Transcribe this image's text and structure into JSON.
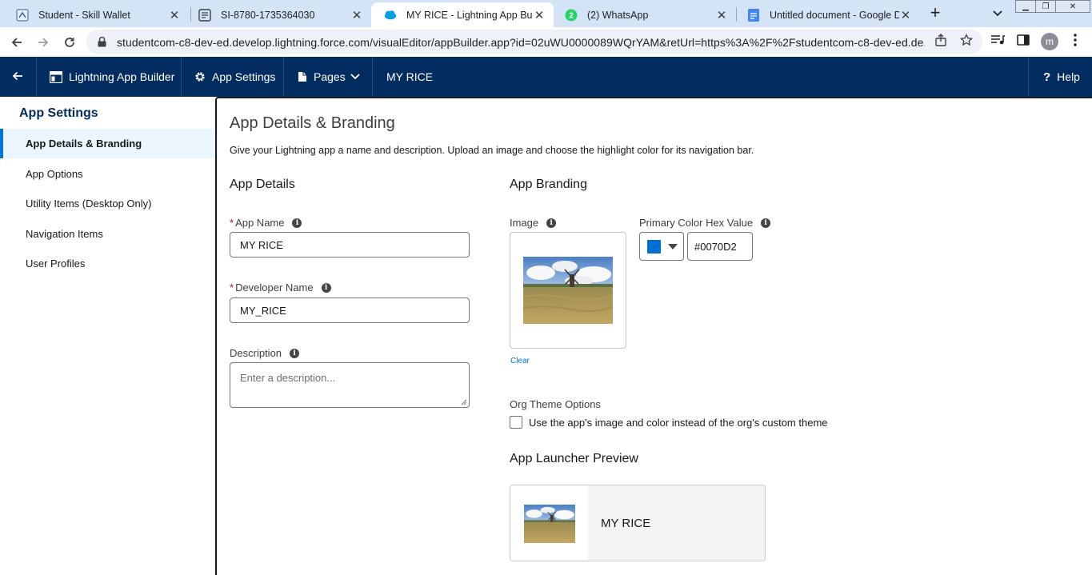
{
  "browser": {
    "tabs": [
      {
        "title": "Student - Skill Wallet",
        "icon": "skill-wallet-icon"
      },
      {
        "title": "SI-8780-1735364030",
        "icon": "form-icon"
      },
      {
        "title": "MY RICE - Lightning App Builder",
        "icon": "salesforce-cloud-icon",
        "active": true
      },
      {
        "title": "(2) WhatsApp",
        "icon": "whatsapp-icon"
      },
      {
        "title": "Untitled document - Google Docs",
        "icon": "google-docs-icon"
      }
    ],
    "url": "studentcom-c8-dev-ed.develop.lightning.force.com/visualEditor/appBuilder.app?id=02uWU0000089WQrYAM&retUrl=https%3A%2F%2Fstudentcom-c8-dev-ed.de...",
    "profile_initial": "m",
    "whatsapp_badge": "2"
  },
  "header": {
    "app_name": "Lightning App Builder",
    "app_settings": "App Settings",
    "pages": "Pages",
    "current_app": "MY RICE",
    "help": "Help"
  },
  "sidebar": {
    "title": "App Settings",
    "items": [
      {
        "label": "App Details & Branding",
        "active": true
      },
      {
        "label": "App Options"
      },
      {
        "label": "Utility Items (Desktop Only)"
      },
      {
        "label": "Navigation Items"
      },
      {
        "label": "User Profiles"
      }
    ]
  },
  "main": {
    "title": "App Details & Branding",
    "intro": "Give your Lightning app a name and description. Upload an image and choose the highlight color for its navigation bar.",
    "details": {
      "heading": "App Details",
      "app_name_label": "App Name",
      "app_name_value": "MY RICE",
      "developer_name_label": "Developer Name",
      "developer_name_value": "MY_RICE",
      "description_label": "Description",
      "description_placeholder": "Enter a description..."
    },
    "branding": {
      "heading": "App Branding",
      "image_label": "Image",
      "clear_link": "Clear",
      "color_label": "Primary Color Hex Value",
      "color_hex": "#0070D2",
      "org_theme_label": "Org Theme Options",
      "org_theme_checkbox": "Use the app's image and color instead of the org's custom theme",
      "org_theme_checked": false
    },
    "preview": {
      "heading": "App Launcher Preview",
      "app_name": "MY RICE"
    }
  },
  "colors": {
    "header_bg": "#032d60",
    "brand_color": "#0070d2",
    "active_accent": "#0176d3",
    "required": "#ba0517"
  }
}
